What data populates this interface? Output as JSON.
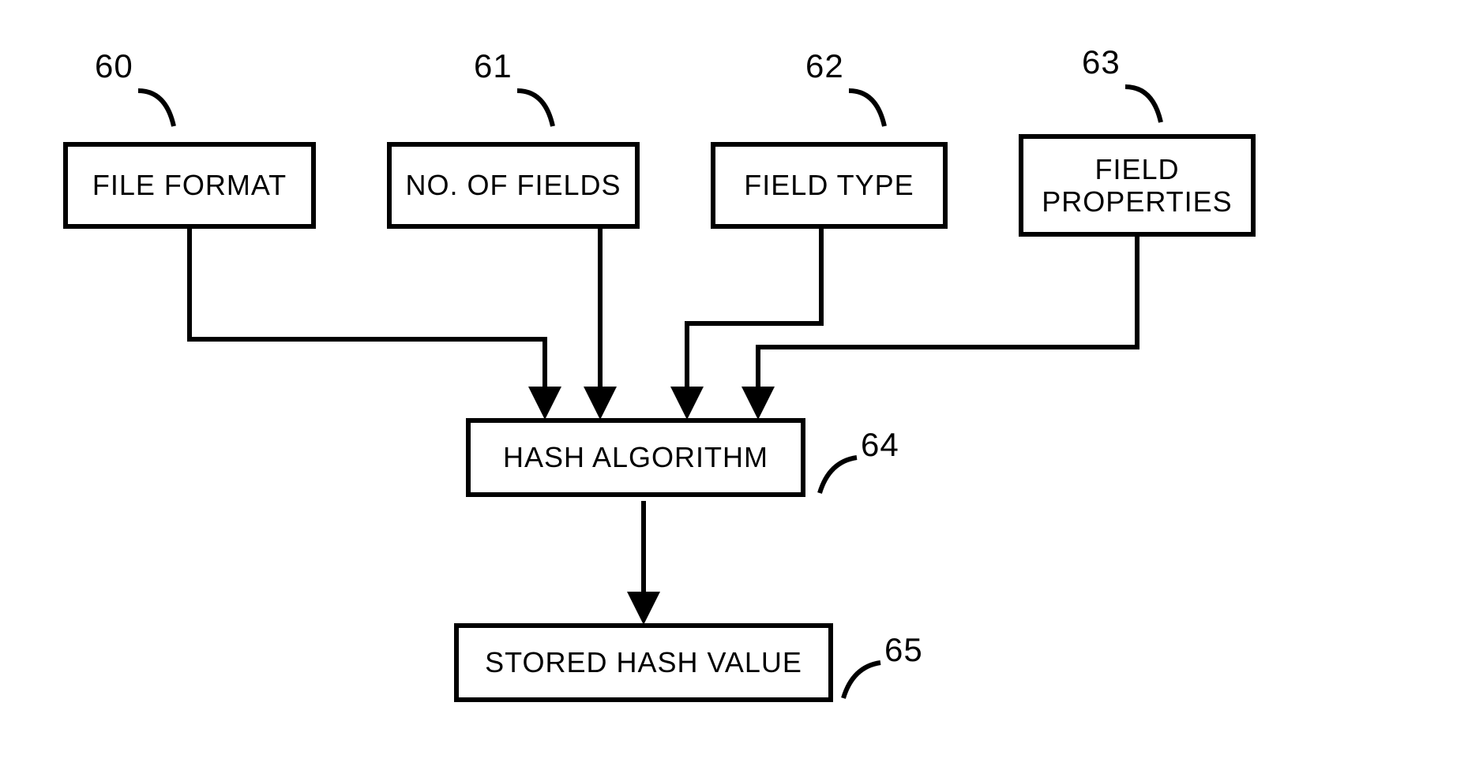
{
  "nodes": {
    "n60": {
      "ref": "60",
      "label": "FILE FORMAT"
    },
    "n61": {
      "ref": "61",
      "label": "NO. OF FIELDS"
    },
    "n62": {
      "ref": "62",
      "label": "FIELD TYPE"
    },
    "n63": {
      "ref": "63",
      "label": "FIELD\nPROPERTIES"
    },
    "n64": {
      "ref": "64",
      "label": "HASH ALGORITHM"
    },
    "n65": {
      "ref": "65",
      "label": "STORED HASH VALUE"
    }
  }
}
